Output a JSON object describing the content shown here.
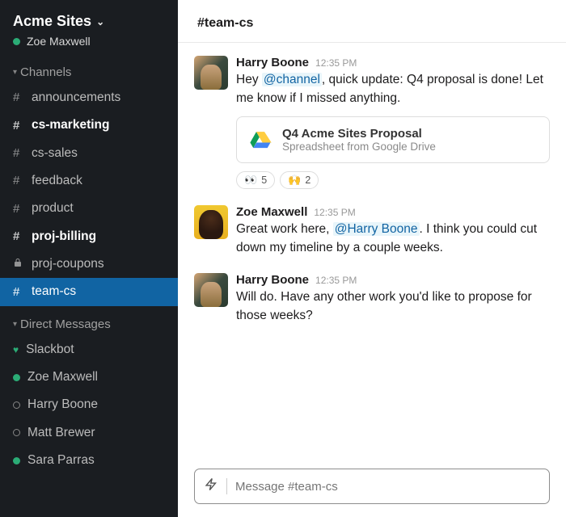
{
  "workspace": {
    "name": "Acme Sites",
    "current_user": "Zoe Maxwell"
  },
  "sidebar": {
    "channels_header": "Channels",
    "dm_header": "Direct Messages",
    "channels": [
      {
        "name": "announcements",
        "type": "public",
        "unread": false,
        "active": false
      },
      {
        "name": "cs-marketing",
        "type": "public",
        "unread": true,
        "active": false
      },
      {
        "name": "cs-sales",
        "type": "public",
        "unread": false,
        "active": false
      },
      {
        "name": "feedback",
        "type": "public",
        "unread": false,
        "active": false
      },
      {
        "name": "product",
        "type": "public",
        "unread": false,
        "active": false
      },
      {
        "name": "proj-billing",
        "type": "public",
        "unread": true,
        "active": false
      },
      {
        "name": "proj-coupons",
        "type": "private",
        "unread": false,
        "active": false
      },
      {
        "name": "team-cs",
        "type": "public",
        "unread": false,
        "active": true
      }
    ],
    "dms": [
      {
        "name": "Slackbot",
        "presence": "heart"
      },
      {
        "name": "Zoe Maxwell",
        "presence": "active"
      },
      {
        "name": "Harry Boone",
        "presence": "away"
      },
      {
        "name": "Matt Brewer",
        "presence": "away"
      },
      {
        "name": "Sara Parras",
        "presence": "active"
      }
    ]
  },
  "channel": {
    "title": "#team-cs"
  },
  "messages": [
    {
      "author": "Harry Boone",
      "time": "12:35 PM",
      "avatar": "harry",
      "text_pre": "Hey ",
      "mention": "@channel",
      "text_post": ", quick update: Q4 proposal is done! Let me know if I missed anything.",
      "attachment": {
        "title": "Q4 Acme Sites Proposal",
        "subtitle": "Spreadsheet from Google Drive"
      },
      "reactions": [
        {
          "emoji": "👀",
          "count": "5"
        },
        {
          "emoji": "🙌",
          "count": "2"
        }
      ]
    },
    {
      "author": "Zoe Maxwell",
      "time": "12:35 PM",
      "avatar": "zoe",
      "text_pre": "Great work here, ",
      "mention": "@Harry Boone",
      "text_post": ". I think you could cut down my timeline by a couple weeks."
    },
    {
      "author": "Harry Boone",
      "time": "12:35 PM",
      "avatar": "harry",
      "text_full": "Will do. Have any other work you'd like to propose for those weeks?"
    }
  ],
  "composer": {
    "placeholder": "Message #team-cs"
  }
}
